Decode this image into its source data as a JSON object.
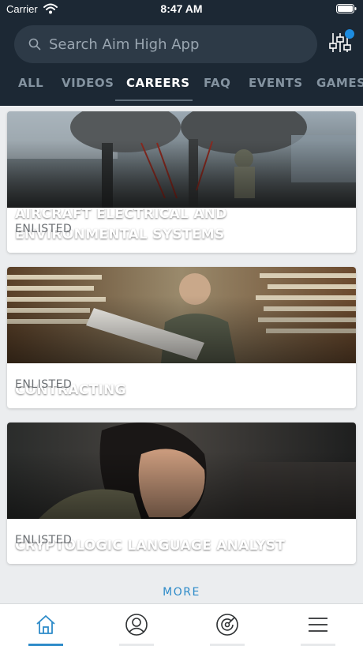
{
  "status_bar": {
    "carrier": "Carrier",
    "time": "8:47 AM"
  },
  "search": {
    "placeholder": "Search Aim High App"
  },
  "tabs": [
    {
      "label": "ALL",
      "active": false
    },
    {
      "label": "VIDEOS",
      "active": false
    },
    {
      "label": "CAREERS",
      "active": true
    },
    {
      "label": "FAQ",
      "active": false
    },
    {
      "label": "EVENTS",
      "active": false
    },
    {
      "label": "GAMES",
      "active": false
    }
  ],
  "cards": [
    {
      "title": "AIRCRAFT ELECTRICAL AND ENVIRONMENTAL SYSTEMS",
      "tag": "ENLISTED"
    },
    {
      "title": "CONTRACTING",
      "tag": "ENLISTED"
    },
    {
      "title": "CRYPTOLOGIC LANGUAGE ANALYST",
      "tag": "ENLISTED"
    }
  ],
  "more_label": "MORE",
  "bottom_nav": [
    {
      "icon": "home-icon",
      "active": true
    },
    {
      "icon": "profile-icon",
      "active": false
    },
    {
      "icon": "target-icon",
      "active": false
    },
    {
      "icon": "menu-icon",
      "active": false
    }
  ],
  "colors": {
    "header_bg": "#1c2834",
    "accent": "#2d8bc9",
    "badge": "#1d8ce0",
    "page_bg": "#ebedef"
  }
}
